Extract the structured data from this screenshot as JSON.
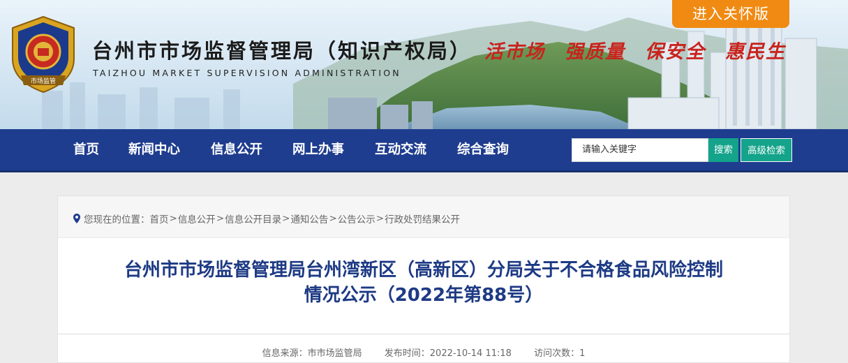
{
  "header": {
    "care_button": "进入关怀版",
    "title_cn": "台州市市场监督管理局（知识产权局）",
    "title_en": "TAIZHOU MARKET SUPERVISION ADMINISTRATION",
    "emblem_text": "市场监管",
    "slogans": [
      "活市场",
      "强质量",
      "保安全",
      "惠民生"
    ]
  },
  "nav": {
    "items": [
      "首页",
      "新闻中心",
      "信息公开",
      "网上办事",
      "互动交流",
      "综合查询"
    ]
  },
  "search": {
    "placeholder": "请输入关键字",
    "search_label": "搜索",
    "advanced_label": "高级检索"
  },
  "breadcrumb": {
    "prefix": "您现在的位置：",
    "items": [
      "首页",
      "信息公开",
      "信息公开目录",
      "通知公告",
      "公告公示",
      "行政处罚结果公开"
    ]
  },
  "article": {
    "title_line1": "台州市市场监督管理局台州湾新区（高新区）分局关于不合格食品风险控制",
    "title_line2": "情况公示（2022年第88号）",
    "source": "信息来源：市市场监管局",
    "published": "发布时间：2022-10-14 11:18",
    "views": "访问次数：1"
  },
  "colors": {
    "nav_bg": "#1f3d8f",
    "care_button": "#f08a12",
    "search_button": "#14a38b",
    "slogan_red": "#c8231c",
    "title_blue": "#1d3a84"
  }
}
